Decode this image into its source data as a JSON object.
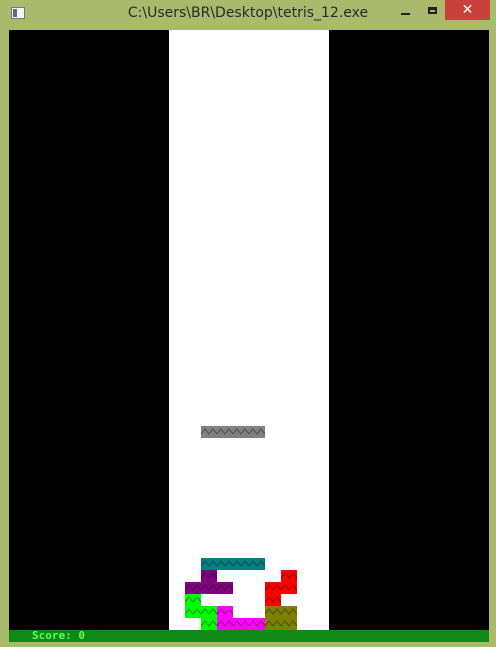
{
  "window": {
    "title": "C:\\Users\\BR\\Desktop\\tetris_12.exe",
    "close_glyph": "✕"
  },
  "status": {
    "score_text": "Score: 0"
  },
  "colors": {
    "gray": "#808080",
    "teal": "#008080",
    "purple": "#800080",
    "red": "#ff0000",
    "green": "#00ff00",
    "magenta": "#ff00ff",
    "olive": "#808000"
  },
  "game": {
    "columns": 10,
    "rows": 50,
    "falling_piece": {
      "color": "gray",
      "cells": [
        [
          2,
          33
        ],
        [
          3,
          33
        ],
        [
          4,
          33
        ],
        [
          5,
          33
        ]
      ]
    },
    "board": [
      {
        "color": "teal",
        "cells": [
          [
            2,
            44
          ],
          [
            3,
            44
          ],
          [
            4,
            44
          ],
          [
            5,
            44
          ]
        ]
      },
      {
        "color": "purple",
        "cells": [
          [
            2,
            45
          ],
          [
            1,
            46
          ],
          [
            2,
            46
          ],
          [
            3,
            46
          ]
        ]
      },
      {
        "color": "red",
        "cells": [
          [
            7,
            45
          ],
          [
            6,
            46
          ],
          [
            7,
            46
          ],
          [
            6,
            47
          ]
        ]
      },
      {
        "color": "green",
        "cells": [
          [
            1,
            47
          ],
          [
            1,
            48
          ],
          [
            2,
            48
          ],
          [
            2,
            49
          ]
        ]
      },
      {
        "color": "magenta",
        "cells": [
          [
            3,
            48
          ],
          [
            3,
            49
          ],
          [
            4,
            49
          ],
          [
            5,
            49
          ]
        ]
      },
      {
        "color": "olive",
        "cells": [
          [
            6,
            48
          ],
          [
            7,
            48
          ],
          [
            6,
            49
          ],
          [
            7,
            49
          ]
        ]
      }
    ]
  }
}
